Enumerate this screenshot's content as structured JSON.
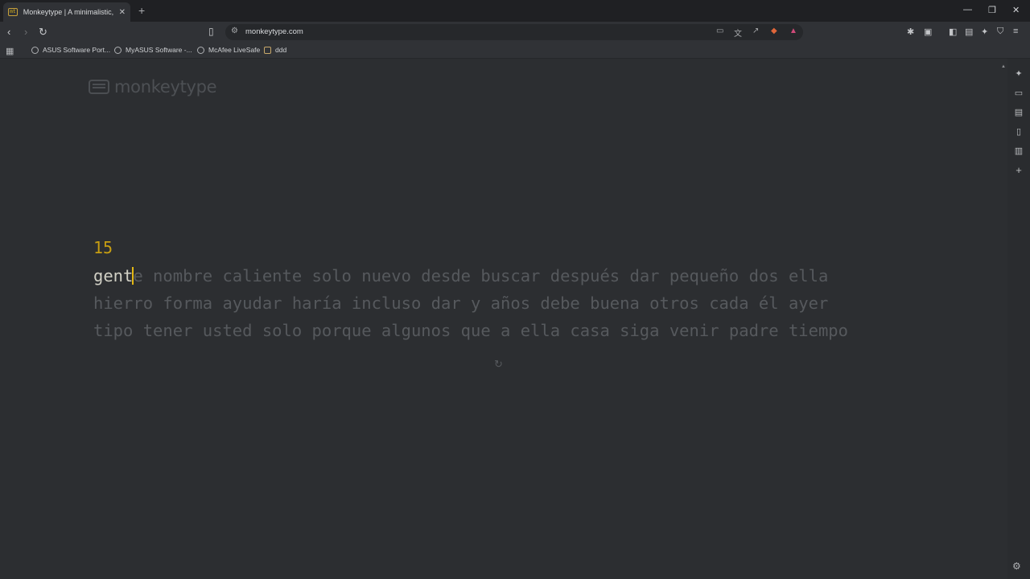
{
  "browser": {
    "tab_title": "Monkeytype | A minimalistic, cu",
    "tab_favicon": "mt",
    "url": "monkeytype.com",
    "bookmarks": [
      {
        "label": "ASUS Software Port..."
      },
      {
        "label": "MyASUS Software -..."
      },
      {
        "label": "McAfee LiveSafe"
      },
      {
        "label": "ddd"
      }
    ]
  },
  "app": {
    "logo": "monkeytype",
    "timer": "15",
    "typed_word": "gent",
    "remaining_word": "e",
    "lines": [
      " nombre caliente solo nuevo desde buscar después dar pequeño dos ella",
      "hierro forma ayudar haría incluso dar y años debe buena otros cada él ayer",
      "tipo tener usted solo porque algunos que a ella casa siga venir padre tiempo"
    ],
    "accent_color": "#e2b714",
    "untyped_color": "#56595d",
    "typed_color": "#d1d0c5",
    "background_color": "#2c2e31"
  }
}
